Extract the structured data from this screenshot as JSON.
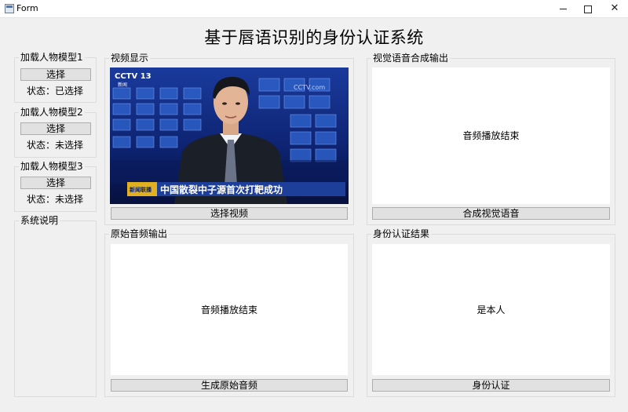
{
  "window": {
    "title": "Form",
    "minimize_icon": "minimize-icon",
    "maximize_icon": "maximize-icon",
    "close_icon": "close-icon"
  },
  "page_title": "基于唇语识别的身份认证系统",
  "models": [
    {
      "title": "加载人物模型1",
      "button": "选择",
      "status": "状态：已选择"
    },
    {
      "title": "加载人物模型2",
      "button": "选择",
      "status": "状态：未选择"
    },
    {
      "title": "加载人物模型3",
      "button": "选择",
      "status": "状态：未选择"
    }
  ],
  "system_info": {
    "title": "系统说明"
  },
  "video": {
    "title": "视频显示",
    "button": "选择视频",
    "channel_logo": "CCTV 13",
    "channel_sub": "新闻",
    "watermark": "CCTV.com",
    "badge": "新闻联播",
    "caption": "中国散裂中子源首次打靶成功"
  },
  "synth": {
    "title": "视觉语音合成输出",
    "status": "音频播放结束",
    "button": "合成视觉语音"
  },
  "original": {
    "title": "原始音频输出",
    "status": "音频播放结束",
    "button": "生成原始音频"
  },
  "auth": {
    "title": "身份认证结果",
    "status": "是本人",
    "button": "身份认证"
  },
  "colors": {
    "window_bg": "#f0f0f0",
    "panel_bg": "#ffffff",
    "button_bg": "#e1e1e1",
    "caption_bar": "#1d3f9a"
  }
}
